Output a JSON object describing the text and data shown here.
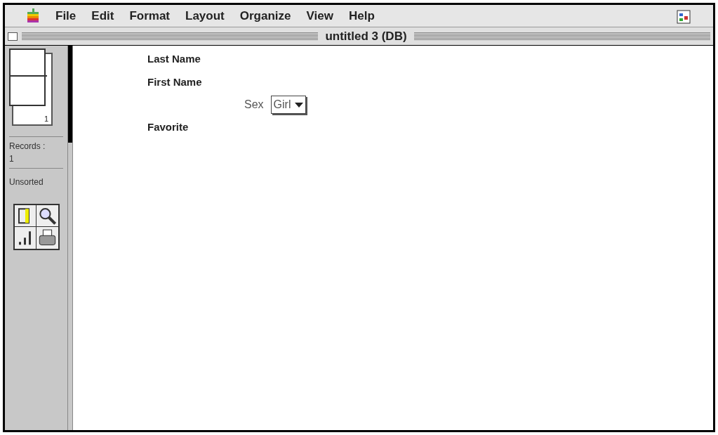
{
  "menu_bar": {
    "items": [
      {
        "label": "File"
      },
      {
        "label": "Edit"
      },
      {
        "label": "Format"
      },
      {
        "label": "Layout"
      },
      {
        "label": "Organize"
      },
      {
        "label": "View"
      },
      {
        "label": "Help"
      }
    ]
  },
  "window": {
    "title": "untitled 3 (DB)"
  },
  "sidebar": {
    "page_number": "1",
    "records_label": "Records :",
    "records_count": "1",
    "sort_status": "Unsorted"
  },
  "form": {
    "fields": [
      {
        "kind": "label",
        "label": "Last Name"
      },
      {
        "kind": "label",
        "label": "First Name"
      },
      {
        "kind": "popup",
        "label": "Sex",
        "value": "Girl"
      },
      {
        "kind": "label",
        "label": "Favorite"
      }
    ]
  }
}
